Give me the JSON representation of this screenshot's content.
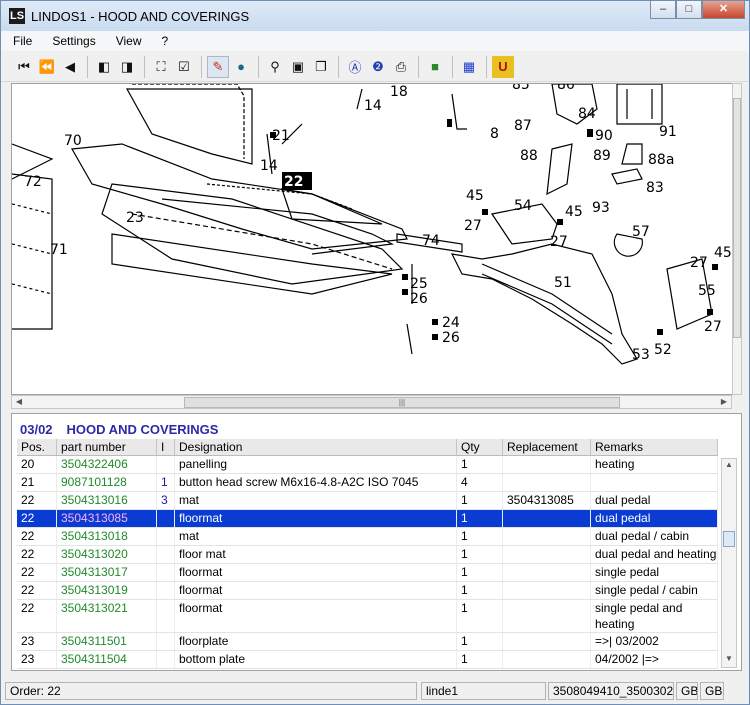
{
  "window": {
    "title": "LINDOS1 - HOOD AND COVERINGS",
    "app_icon": "LS"
  },
  "menu": [
    "File",
    "Settings",
    "View",
    "?"
  ],
  "toolbar": {
    "icons": [
      "first-icon",
      "prev-page-icon",
      "prev-icon",
      "split-left-icon",
      "split-right-icon",
      "cart-icon",
      "checklist-icon",
      "marker-icon",
      "globe-icon",
      "zoom-icon",
      "page-icon",
      "copy-page-icon",
      "letter-a-icon",
      "help-icon",
      "print-icon",
      "book-icon",
      "grid-icon",
      "u-icon"
    ]
  },
  "drawing": {
    "callouts": [
      "18",
      "14",
      "85",
      "84",
      "86",
      "87",
      "8",
      "90",
      "91",
      "21",
      "14",
      "88",
      "89",
      "88a",
      "70",
      "22",
      "72",
      "83",
      "45",
      "54",
      "93",
      "45",
      "27",
      "27",
      "57",
      "23",
      "74",
      "71",
      "45",
      "27",
      "51",
      "55",
      "25",
      "26",
      "27",
      "24",
      "26",
      "52",
      "53"
    ]
  },
  "parts": {
    "section_code": "03/02",
    "section_title": "HOOD AND COVERINGS",
    "columns": [
      "Pos.",
      "part number",
      "I",
      "Designation",
      "Qty",
      "Replacement",
      "Remarks"
    ],
    "rows": [
      {
        "pos": "20",
        "pn": "3504322406",
        "i": "",
        "designation": "panelling",
        "qty": "1",
        "repl": "",
        "remarks": "heating"
      },
      {
        "pos": "21",
        "pn": "9087101128",
        "i": "1",
        "designation": "button head screw M6x16-4.8-A2C  ISO 7045",
        "qty": "4",
        "repl": "",
        "remarks": ""
      },
      {
        "pos": "22",
        "pn": "3504313016",
        "i": "3",
        "designation": "mat",
        "qty": "1",
        "repl": "3504313085",
        "remarks": "dual pedal"
      },
      {
        "pos": "22",
        "pn": "3504313085",
        "i": "",
        "designation": "floormat",
        "qty": "1",
        "repl": "",
        "remarks": "dual pedal"
      },
      {
        "pos": "22",
        "pn": "3504313018",
        "i": "",
        "designation": "mat",
        "qty": "1",
        "repl": "",
        "remarks": "dual pedal / cabin"
      },
      {
        "pos": "22",
        "pn": "3504313020",
        "i": "",
        "designation": "floor mat",
        "qty": "1",
        "repl": "",
        "remarks": "dual pedal and heating"
      },
      {
        "pos": "22",
        "pn": "3504313017",
        "i": "",
        "designation": "floormat",
        "qty": "1",
        "repl": "",
        "remarks": "single pedal"
      },
      {
        "pos": "22",
        "pn": "3504313019",
        "i": "",
        "designation": "floormat",
        "qty": "1",
        "repl": "",
        "remarks": "single pedal / cabin"
      },
      {
        "pos": "22",
        "pn": "3504313021",
        "i": "",
        "designation": "floormat",
        "qty": "1",
        "repl": "",
        "remarks": "single pedal and heating"
      },
      {
        "pos": "23",
        "pn": "3504311501",
        "i": "",
        "designation": "floorplate",
        "qty": "1",
        "repl": "",
        "remarks": "=>| 03/2002"
      },
      {
        "pos": "23",
        "pn": "3504311504",
        "i": "",
        "designation": "bottom plate",
        "qty": "1",
        "repl": "",
        "remarks": "04/2002 |=>"
      }
    ],
    "selected_index": 3
  },
  "status": {
    "order": "Order: 22",
    "user": "linde1",
    "serial": "3508049410_3500302",
    "lang1": "GB",
    "lang2": "GB"
  },
  "colors": {
    "selection": "#0a3cd4",
    "part_number": "#1f8a2a",
    "section": "#2a2aa8"
  }
}
